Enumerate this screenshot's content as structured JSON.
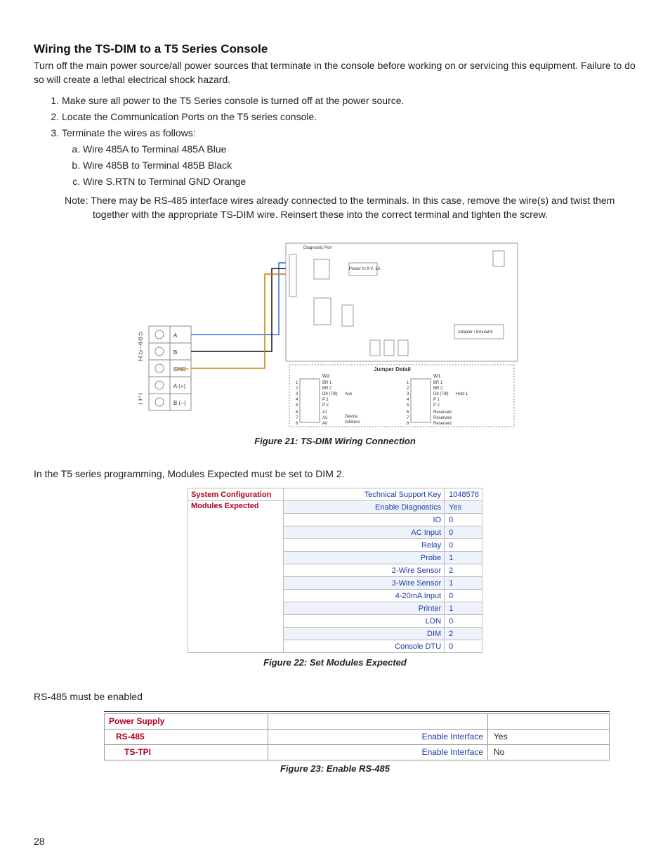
{
  "heading": "Wiring the TS-DIM to a T5 Series Console",
  "intro": "Turn off the main power source/all power sources that terminate in the console before working on or servicing this equipment. Failure to do so will create a lethal electrical shock hazard.",
  "steps": [
    "Make sure all power to the T5 Series console is turned off at the power source.",
    "Locate the Communication Ports on the T5 series console.",
    "Terminate the wires as follows:"
  ],
  "substeps": [
    "Wire 485A to Terminal 485A Blue",
    "Wire 485B to Terminal 485B Black",
    "Wire S.RTN to Terminal GND Orange"
  ],
  "note": "Note: There may be RS-485 interface wires already connected to the terminals. In this case, remove the wire(s) and twist them together with the appropriate TS-DIM wire. Reinsert these into the correct terminal and tighten the screw.",
  "fig21_caption": "Figure 21: TS-DIM Wiring Connection",
  "fig21_labels": {
    "vert_rs485": "RS-485",
    "vert_tpi": "TPI",
    "port_a": "A",
    "port_b": "B",
    "port_gnd": "GND",
    "port_tpi_a": "A (+)",
    "port_tpi_b": "B (−)",
    "jumper_title": "Jumper Detail",
    "w1": "W1",
    "w2": "W2",
    "aux": "Aux",
    "host1": "Host 1",
    "dev_addr": "Device\nAddress",
    "row_br1": "BR 1",
    "row_br2": "BR 2",
    "row_d9": "D9 (7/8)",
    "row_p1": "P 1",
    "row_p2": "P 2",
    "row_a1": "A1",
    "row_a2": "A2",
    "row_a0": "A0",
    "row_res": "Reserved",
    "adapter": "Adapter / Emulator",
    "diag_port": "Diagnostic Port",
    "power_in": "Power In\n9 V, 1A"
  },
  "mid_text": "In the T5 series programming, Modules Expected must be set to DIM 2.",
  "fig22": {
    "title_left": "System Configuration",
    "modules_expected": "Modules Expected",
    "caption": "Figure 22: Set Modules Expected",
    "rows": [
      {
        "label": "Technical Support Key",
        "value": "1048576"
      },
      {
        "label": "Enable Diagnostics",
        "value": "Yes"
      },
      {
        "label": "IO",
        "value": "0"
      },
      {
        "label": "AC Input",
        "value": "0"
      },
      {
        "label": "Relay",
        "value": "0"
      },
      {
        "label": "Probe",
        "value": "1"
      },
      {
        "label": "2-Wire Sensor",
        "value": "2"
      },
      {
        "label": "3-Wire Sensor",
        "value": "1"
      },
      {
        "label": "4-20mA Input",
        "value": "0"
      },
      {
        "label": "Printer",
        "value": "1"
      },
      {
        "label": "LON",
        "value": "0"
      },
      {
        "label": "DIM",
        "value": "2"
      },
      {
        "label": "Console DTU",
        "value": "0"
      }
    ]
  },
  "rs485_text": "RS-485 must be enabled",
  "fig23": {
    "power_supply": "Power Supply",
    "rs485": "RS-485",
    "tstpi": "TS-TPI",
    "label1": "Enable Interface",
    "value1": "Yes",
    "label2": "Enable Interface",
    "value2": "No",
    "caption": "Figure 23: Enable RS-485"
  },
  "page_number": "28"
}
